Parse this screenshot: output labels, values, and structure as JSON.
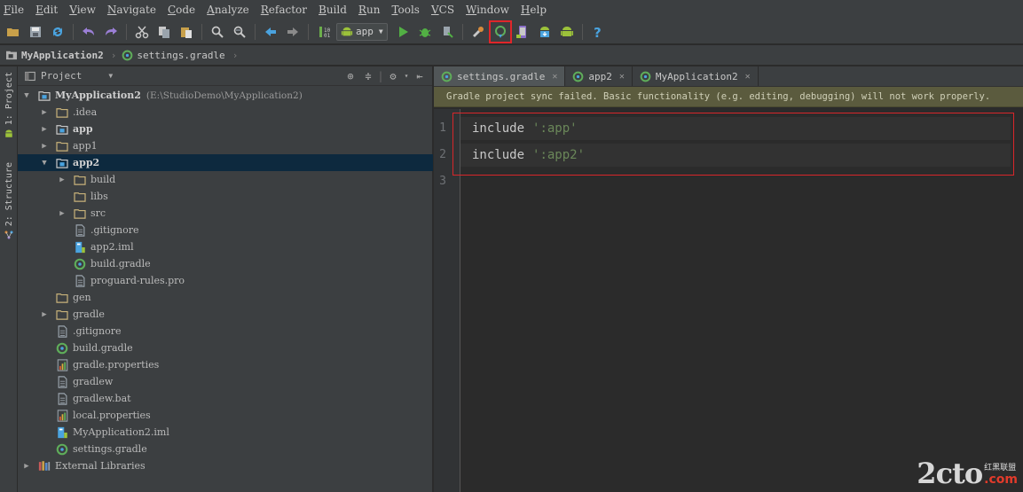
{
  "menu": [
    "File",
    "Edit",
    "View",
    "Navigate",
    "Code",
    "Analyze",
    "Refactor",
    "Build",
    "Run",
    "Tools",
    "VCS",
    "Window",
    "Help"
  ],
  "toolbar": {
    "run_config_label": "app",
    "icons": [
      "open-folder-icon",
      "save-icon",
      "sync-icon",
      "undo-icon",
      "redo-icon",
      "cut-icon",
      "copy-icon",
      "paste-icon",
      "find-icon",
      "replace-icon",
      "back-icon",
      "forward-icon",
      "make-project-icon",
      "run-icon",
      "debug-icon",
      "attach-debugger-icon",
      "project-structure-icon",
      "sync-gradle-icon",
      "avd-manager-icon",
      "sdk-manager-icon",
      "android-device-monitor-icon",
      "help-icon"
    ]
  },
  "breadcrumb": [
    "MyApplication2",
    "settings.gradle"
  ],
  "left_strip": {
    "project_tab": "1: Project",
    "structure_tab": "2: Structure"
  },
  "project_panel": {
    "view_selector": "Project",
    "tree": [
      {
        "label": "MyApplication2",
        "path": "(E:\\StudioDemo\\MyApplication2)",
        "bold": true
      },
      {
        "label": ".idea"
      },
      {
        "label": "app",
        "bold": true
      },
      {
        "label": "app1"
      },
      {
        "label": "app2",
        "bold": true
      },
      {
        "label": "build"
      },
      {
        "label": "libs"
      },
      {
        "label": "src"
      },
      {
        "label": ".gitignore"
      },
      {
        "label": "app2.iml"
      },
      {
        "label": "build.gradle"
      },
      {
        "label": "proguard-rules.pro"
      },
      {
        "label": "gen"
      },
      {
        "label": "gradle"
      },
      {
        "label": ".gitignore"
      },
      {
        "label": "build.gradle"
      },
      {
        "label": "gradle.properties"
      },
      {
        "label": "gradlew"
      },
      {
        "label": "gradlew.bat"
      },
      {
        "label": "local.properties"
      },
      {
        "label": "MyApplication2.iml"
      },
      {
        "label": "settings.gradle"
      },
      {
        "label": "External Libraries"
      }
    ]
  },
  "editor": {
    "tabs": [
      {
        "label": "settings.gradle",
        "active": true
      },
      {
        "label": "app2",
        "active": false
      },
      {
        "label": "MyApplication2",
        "active": false
      }
    ],
    "notification": "Gradle project sync failed. Basic functionality (e.g. editing, debugging) will not work properly.",
    "lines": [
      {
        "num": "1",
        "keyword": "include",
        "string": "':app'"
      },
      {
        "num": "2",
        "keyword": "include",
        "string": "':app2'"
      },
      {
        "num": "3",
        "keyword": "",
        "string": ""
      }
    ]
  },
  "watermark": {
    "logo": "2cto",
    "sub": "红黑联盟",
    "domain": ".com"
  },
  "colors": {
    "accent_red": "#e0262a",
    "selection": "#0d293e",
    "string": "#6a8759",
    "notify_bg": "#5b5b3e"
  }
}
